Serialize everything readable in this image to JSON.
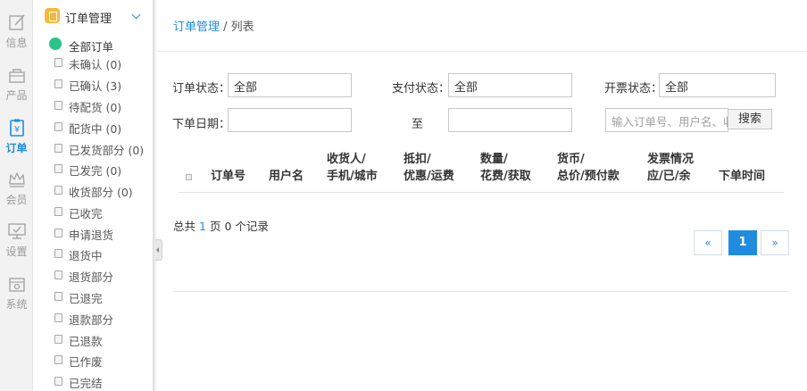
{
  "rail": [
    {
      "label": "信息",
      "icon": "edit-icon"
    },
    {
      "label": "产品",
      "icon": "bag-icon"
    },
    {
      "label": "订单",
      "icon": "order-icon",
      "active": true
    },
    {
      "label": "会员",
      "icon": "crown-icon"
    },
    {
      "label": "设置",
      "icon": "monitor-check-icon"
    },
    {
      "label": "系统",
      "icon": "gear-box-icon"
    }
  ],
  "submenu": {
    "title": "订单管理",
    "items": [
      "全部订单",
      "未确认 (0)",
      "已确认 (3)",
      "待配货 (0)",
      "配货中 (0)",
      "已发货部分 (0)",
      "已发完 (0)",
      "收货部分 (0)",
      "已收完",
      "申请退货",
      "退货中",
      "退货部分",
      "已退完",
      "退款部分",
      "已退款",
      "已作废",
      "已完结"
    ]
  },
  "breadcrumb": {
    "link": "订单管理",
    "separator": " / ",
    "current": "列表"
  },
  "filters": {
    "order_status_label": "订单状态：",
    "order_status_value": "全部",
    "pay_status_label": "支付状态：",
    "pay_status_value": "全部",
    "invoice_status_label": "开票状态：",
    "invoice_status_value": "全部",
    "date_label": "下单日期：",
    "date_to": "至",
    "search_placeholder": "输入订单号、用户名、收",
    "search_button": "搜索"
  },
  "table": {
    "headers": [
      [
        "订单号"
      ],
      [
        "用户名"
      ],
      [
        "收货人/",
        "手机/城市"
      ],
      [
        "抵扣/",
        "优惠/运费"
      ],
      [
        "数量/",
        "花费/获取"
      ],
      [
        "货币/",
        "总价/预付款"
      ],
      [
        "发票情况",
        "应/已/余"
      ],
      [
        "下单时间"
      ]
    ]
  },
  "summary": {
    "prefix": "总共",
    "pages": "1",
    "middle": "页",
    "records": "0",
    "suffix": "个记录"
  },
  "pagination": {
    "prev": "«",
    "current": "1",
    "next": "»"
  },
  "colors": {
    "accent": "#1f8ce0",
    "menu_title_icon": "#f5b93a",
    "all_orders_icon": "#2cc38b"
  }
}
